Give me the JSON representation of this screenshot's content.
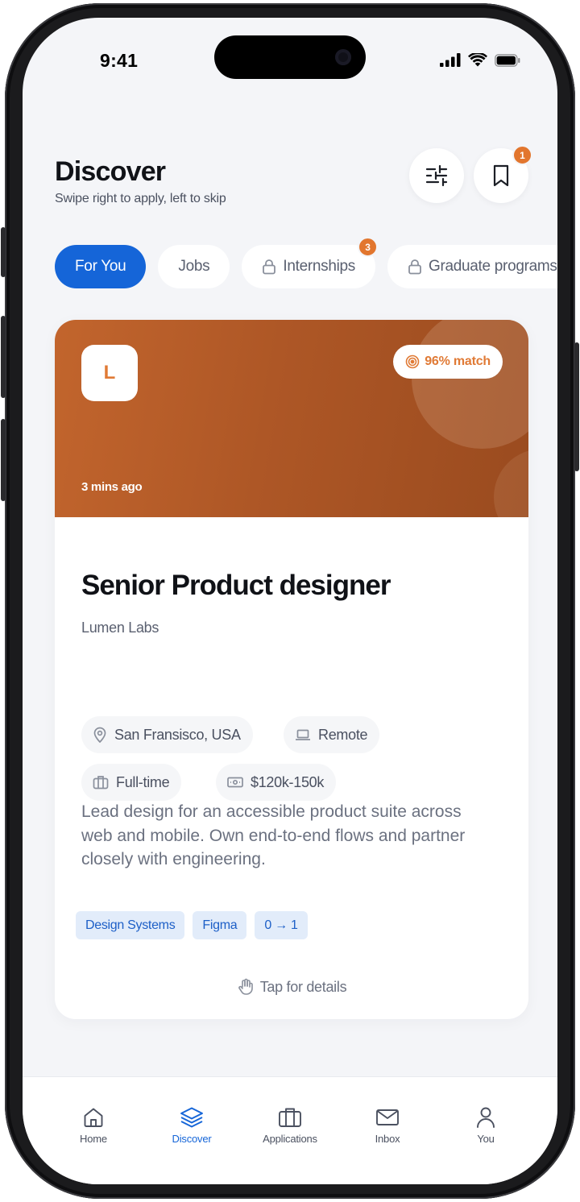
{
  "status_bar": {
    "time": "9:41"
  },
  "header": {
    "title": "Discover",
    "subtitle": "Swipe right to apply, left to skip",
    "saved_badge": "1"
  },
  "tabs": [
    {
      "label": "For You",
      "active": true
    },
    {
      "label": "Jobs"
    },
    {
      "label": "Internships",
      "locked": true,
      "badge": "3"
    },
    {
      "label": "Graduate programs",
      "locked": true
    }
  ],
  "card": {
    "logo_letter": "L",
    "match": "96% match",
    "posted": "3 mins ago",
    "title": "Senior Product designer",
    "company": "Lumen Labs",
    "location": "San Fransisco, USA",
    "work_mode": "Remote",
    "employment_type": "Full-time",
    "salary": "$120k-150k",
    "description": "Lead design for an accessible product suite across web and mobile. Own end-to-end flows and partner closely with engineering.",
    "skills": [
      "Design Systems",
      "Figma",
      "0 → 1"
    ],
    "tap_hint": "Tap for details"
  },
  "bottom_nav": [
    {
      "label": "Home",
      "icon": "home-icon"
    },
    {
      "label": "Discover",
      "icon": "layers-icon",
      "active": true
    },
    {
      "label": "Applications",
      "icon": "briefcase-icon"
    },
    {
      "label": "Inbox",
      "icon": "mail-icon"
    },
    {
      "label": "You",
      "icon": "user-icon"
    }
  ],
  "colors": {
    "accent_blue": "#1565d8",
    "accent_orange": "#e2762e",
    "hero_brown": "#ae5726",
    "background": "#f4f5f8"
  }
}
